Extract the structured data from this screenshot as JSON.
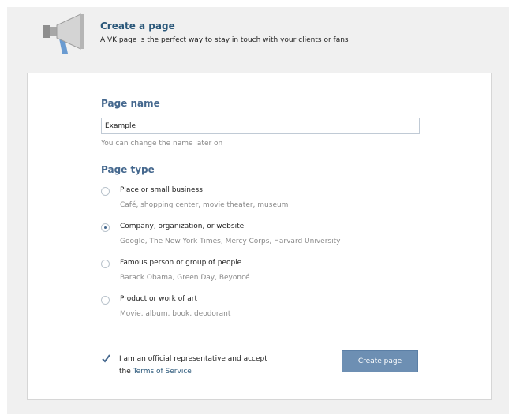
{
  "header": {
    "title": "Create a page",
    "subtitle": "A VK page is the perfect way to stay in touch with your clients or fans",
    "icon": "megaphone-icon"
  },
  "page_name": {
    "label": "Page name",
    "value": "Example",
    "hint": "You can change the name later on"
  },
  "page_type": {
    "label": "Page type",
    "selected_index": 1,
    "options": [
      {
        "label": "Place or small business",
        "examples": "Café, shopping center, movie theater, museum"
      },
      {
        "label": "Company, organization, or website",
        "examples": "Google, The New York Times, Mercy Corps, Harvard University"
      },
      {
        "label": "Famous person or group of people",
        "examples": "Barack Obama, Green Day, Beyoncé"
      },
      {
        "label": "Product or work of art",
        "examples": "Movie, album, book, deodorant"
      }
    ]
  },
  "agreement": {
    "checked": true,
    "text": "I am an official representative and accept",
    "text_prefix_line2": "the",
    "link_label": "Terms of Service"
  },
  "create_button": {
    "label": "Create page"
  },
  "colors": {
    "accent": "#45688e",
    "button": "#6d8fb3",
    "title": "#2b587a"
  }
}
